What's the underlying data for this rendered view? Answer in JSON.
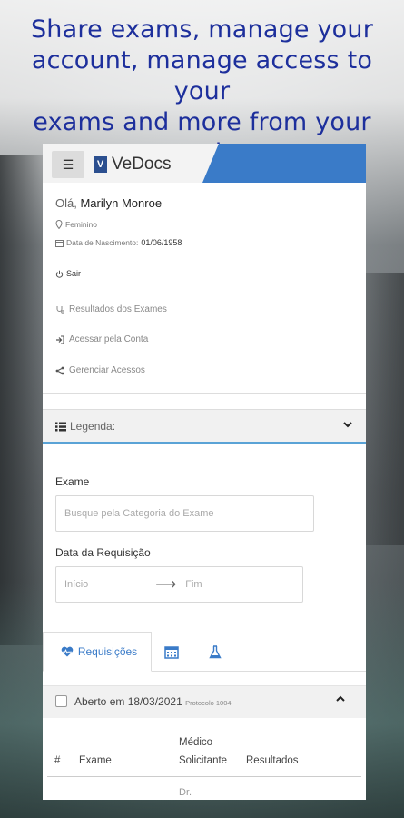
{
  "headline": [
    "Share exams, manage your",
    "account, manage access to your",
    "exams and more from your",
    "smartphone"
  ],
  "app": {
    "menu_icon": "hamburger-icon",
    "logo_mark": "V",
    "logo_text": "VeDocs",
    "accent_color": "#3a7bc8"
  },
  "user": {
    "greeting": "Olá,",
    "name": "Marilyn Monroe",
    "gender": "Feminino",
    "birth_label": "Data de Nascimento:",
    "birth_value": "01/06/1958",
    "logout": "Sair"
  },
  "nav": {
    "results": "Resultados dos Exames",
    "access_account": "Acessar pela Conta",
    "manage_access": "Gerenciar Acessos"
  },
  "legend": {
    "label": "Legenda:"
  },
  "form": {
    "exam_label": "Exame",
    "exam_placeholder": "Busque pela Categoria do Exame",
    "date_label": "Data da Requisição",
    "start_placeholder": "Início",
    "end_placeholder": "Fim",
    "arrow": "⟶"
  },
  "tabs": {
    "requisicoes": "Requisições",
    "calendar_icon": "calendar-icon",
    "flask_icon": "flask-icon"
  },
  "request": {
    "label": "Aberto em 18/03/2021",
    "protocol": "Protocolo 1004"
  },
  "table": {
    "headers": [
      "#",
      "Exame",
      "Médico",
      "Solicitante",
      "Resultados"
    ],
    "first_cell": "Dr."
  }
}
